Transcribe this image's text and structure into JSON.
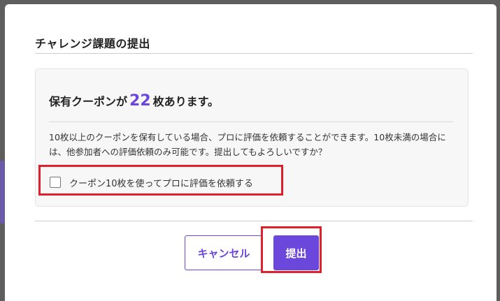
{
  "dialog": {
    "title": "チャレンジ課題の提出",
    "coupon_prefix": "保有クーポンが",
    "coupon_count": "22",
    "coupon_suffix": "枚あります。",
    "message": "10枚以上のクーポンを保有している場合、プロに評価を依頼することができます。10枚未満の場合には、他参加者への評価依頼のみ可能です。提出してもよろしいですか？",
    "checkbox_label": "クーポン10枚を使ってプロに評価を依頼する",
    "checkbox_checked": false,
    "cancel_label": "キャンセル",
    "submit_label": "提出"
  },
  "colors": {
    "accent": "#6b47dc",
    "highlight": "#e0202c",
    "panel_background": "#f7f7f7",
    "overlay": "#5e5e5e"
  }
}
